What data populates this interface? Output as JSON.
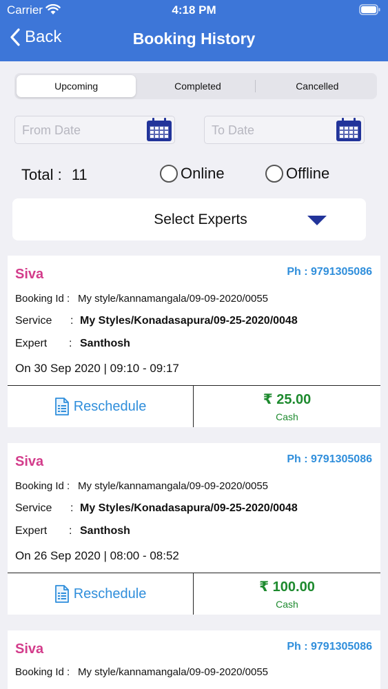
{
  "status_bar": {
    "carrier": "Carrier",
    "time": "4:18 PM"
  },
  "header": {
    "back_label": "Back",
    "title": "Booking History"
  },
  "tabs": [
    {
      "label": "Upcoming",
      "active": true
    },
    {
      "label": "Completed",
      "active": false
    },
    {
      "label": "Cancelled",
      "active": false
    }
  ],
  "filters": {
    "from_placeholder": "From Date",
    "to_placeholder": "To Date",
    "total_label": "Total :",
    "total_value": "11",
    "online_label": "Online",
    "offline_label": "Offline",
    "experts_label": "Select Experts"
  },
  "colors": {
    "header": "#3d76d8",
    "name": "#d33c8b",
    "phone": "#2f8edb",
    "amount": "#1d8a2e",
    "calendar": "#22349a"
  },
  "bookings": [
    {
      "name": "Siva",
      "phone": "Ph : 9791305086",
      "booking_id_label": "Booking Id :",
      "booking_id": "My style/kannamangala/09-09-2020/0055",
      "service_label": "Service",
      "service": "My Styles/Konadasapura/09-25-2020/0048",
      "expert_label": "Expert",
      "expert": "Santhosh",
      "date_line": "On 30 Sep 2020 | 09:10 - 09:17",
      "reschedule_label": "Reschedule",
      "amount": "₹ 25.00",
      "payment": "Cash"
    },
    {
      "name": "Siva",
      "phone": "Ph : 9791305086",
      "booking_id_label": "Booking Id :",
      "booking_id": "My style/kannamangala/09-09-2020/0055",
      "service_label": "Service",
      "service": "My Styles/Konadasapura/09-25-2020/0048",
      "expert_label": "Expert",
      "expert": "Santhosh",
      "date_line": "On 26 Sep 2020 | 08:00 - 08:52",
      "reschedule_label": "Reschedule",
      "amount": "₹ 100.00",
      "payment": "Cash"
    },
    {
      "name": "Siva",
      "phone": "Ph : 9791305086",
      "booking_id_label": "Booking Id :",
      "booking_id": "My style/kannamangala/09-09-2020/0055"
    }
  ]
}
